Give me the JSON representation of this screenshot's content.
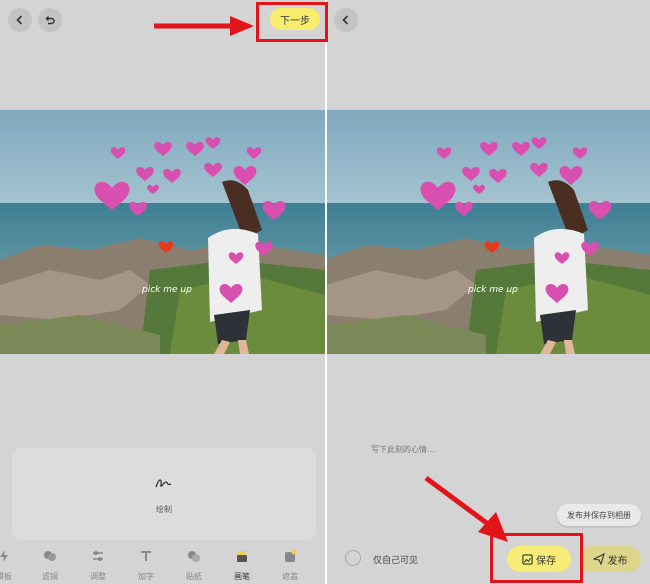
{
  "editor": {
    "next_label": "下一步",
    "watermark": "pick me up",
    "draw_label": "绘制",
    "tools": [
      {
        "label": "模板",
        "icon": "template-icon"
      },
      {
        "label": "滤镜",
        "icon": "filter-icon"
      },
      {
        "label": "调整",
        "icon": "adjust-icon"
      },
      {
        "label": "加字",
        "icon": "text-icon"
      },
      {
        "label": "贴纸",
        "icon": "sticker-icon"
      },
      {
        "label": "画笔",
        "icon": "brush-icon"
      },
      {
        "label": "遮盖",
        "icon": "mask-icon"
      }
    ],
    "active_tool": "画笔"
  },
  "publish": {
    "watermark": "pick me up",
    "caption_placeholder": "写下此刻的心情…",
    "private_label": "仅自己可见",
    "save_label": "保存",
    "publish_label": "发布",
    "tooltip": "发布并保存到相册"
  },
  "colors": {
    "accent_yellow": "#f7ec6e",
    "highlight_red": "#e1141a"
  }
}
